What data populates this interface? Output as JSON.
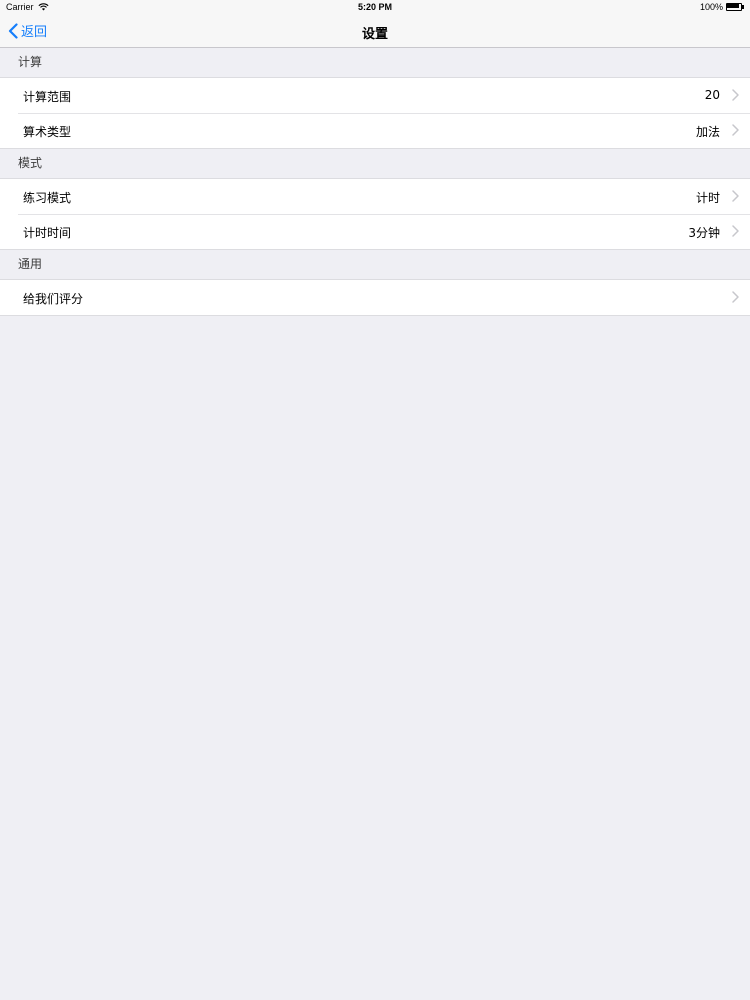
{
  "status_bar": {
    "carrier": "Carrier",
    "time": "5:20 PM",
    "battery_text": "100%",
    "battery_level": 1.0,
    "icons": {
      "wifi": "wifi-icon",
      "battery": "battery-icon"
    }
  },
  "nav": {
    "back_label": "返回",
    "title": "设置",
    "icons": {
      "back": "chevron-left-icon"
    },
    "accent_color": "#157efb"
  },
  "sections": [
    {
      "header": "计算",
      "rows": [
        {
          "label": "计算范围",
          "value": "20"
        },
        {
          "label": "算术类型",
          "value": "加法"
        }
      ]
    },
    {
      "header": "模式",
      "rows": [
        {
          "label": "练习模式",
          "value": "计时"
        },
        {
          "label": "计时时间",
          "value": "3分钟"
        }
      ]
    },
    {
      "header": "通用",
      "rows": [
        {
          "label": "给我们评分",
          "value": ""
        }
      ]
    }
  ],
  "row_icon": "chevron-right-icon",
  "colors": {
    "background": "#efeff4",
    "cell_background": "#ffffff",
    "chevron": "#c7c7cc"
  }
}
